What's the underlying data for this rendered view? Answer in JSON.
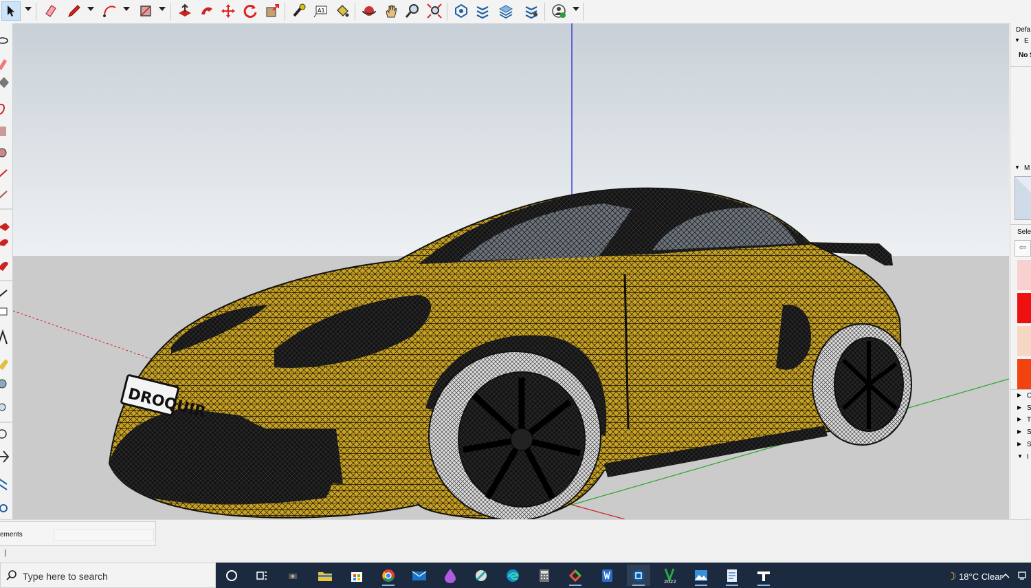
{
  "toolbar": {
    "tools": [
      "select-tool",
      "eraser-tool",
      "line-tool",
      "arc-tool",
      "rectangle-tool",
      "push-pull-tool",
      "follow-me-tool",
      "move-tool",
      "rotate-tool",
      "scale-tool",
      "tape-measure-tool",
      "text-tool",
      "paint-bucket-tool",
      "orbit-tool",
      "pan-tool",
      "zoom-tool",
      "zoom-extents-tool",
      "components-tool",
      "styles-tool",
      "layers-tool",
      "scenes-tool",
      "account-tool"
    ]
  },
  "right_panel": {
    "tray_title": "Defa",
    "entity_label": "No S",
    "select_label": "Sele",
    "section_markers": [
      "C",
      "S",
      "T",
      "S",
      "S",
      "I"
    ]
  },
  "status": {
    "measurements_label": "ements",
    "hint": "|"
  },
  "taskbar": {
    "search_placeholder": "Type here to search",
    "weather": "18°C  Clear",
    "apps": [
      "cortana",
      "task-view",
      "camera",
      "file-explorer",
      "microsoft-store",
      "chrome",
      "mail",
      "paint",
      "settings",
      "edge",
      "calculator",
      "snip",
      "word",
      "sketchup",
      "layout-2022",
      "photos",
      "notepad",
      "typora"
    ]
  },
  "viewport": {
    "plate_text": "DROQUIR",
    "car_color": "#c8a226",
    "sky_top": "#c9d1d8",
    "sky_bottom": "#eef1f3",
    "ground": "#cacaca",
    "axis_blue": "#1b1bd0",
    "axis_red": "#cc2222",
    "axis_green": "#2aa52a"
  }
}
